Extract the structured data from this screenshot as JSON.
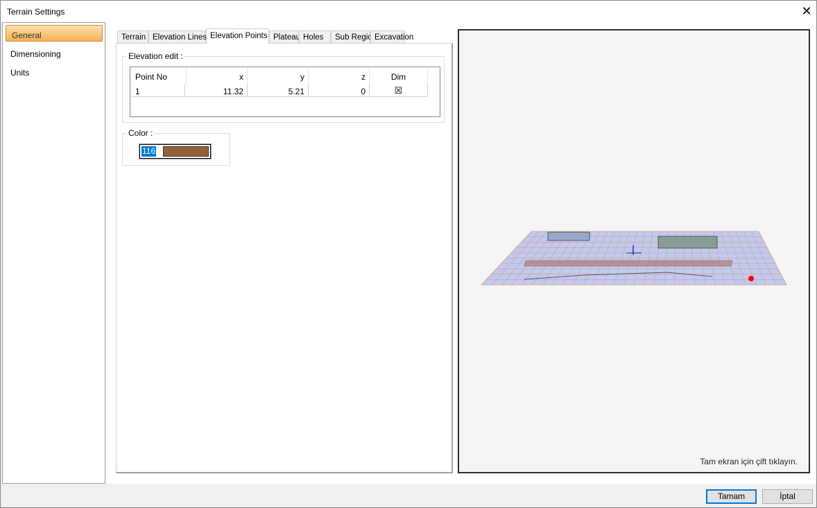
{
  "window": {
    "title": "Terrain Settings"
  },
  "sidebar": {
    "items": [
      {
        "label": "General",
        "active": true
      },
      {
        "label": "Dimensioning"
      },
      {
        "label": "Units"
      }
    ]
  },
  "tabs": [
    {
      "label": "Terrain"
    },
    {
      "label": "Elevation Lines"
    },
    {
      "label": "Elevation Points",
      "active": true
    },
    {
      "label": "Plateau"
    },
    {
      "label": "Holes"
    },
    {
      "label": "Sub Regions"
    },
    {
      "label": "Excavation"
    }
  ],
  "elevation_edit": {
    "label": "Elevation edit :",
    "columns": [
      "Point No",
      "x",
      "y",
      "z",
      "Dim"
    ],
    "rows": [
      {
        "point_no": "1",
        "x": "11.32",
        "y": "5.21",
        "z": "0",
        "dim": "☒"
      }
    ]
  },
  "color": {
    "label": "Color :",
    "value": "116",
    "swatch": "#956134"
  },
  "preview": {
    "hint": "Tam ekran için çift tıklayın."
  },
  "buttons": {
    "ok": "Tamam",
    "cancel": "İptal"
  }
}
